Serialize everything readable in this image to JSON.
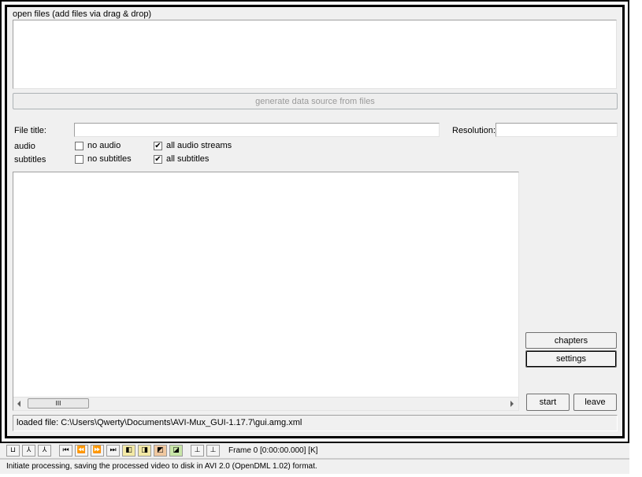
{
  "open_files": {
    "label": "open files (add files via drag & drop)",
    "generate_button": "generate data source from files"
  },
  "file_title": {
    "label": "File title:",
    "value": ""
  },
  "resolution": {
    "label": "Resolution:",
    "value": ""
  },
  "audio": {
    "label": "audio",
    "no_audio": {
      "label": "no audio",
      "checked": false
    },
    "all_streams": {
      "label": "all audio streams",
      "checked": true
    }
  },
  "subtitles": {
    "label": "subtitles",
    "no_subtitles": {
      "label": "no subtitles",
      "checked": false
    },
    "all_subtitles": {
      "label": "all subtitles",
      "checked": true
    }
  },
  "stream_list": {
    "scroll_grip": "III"
  },
  "buttons": {
    "chapters": "chapters",
    "settings": "settings",
    "start": "start",
    "leave": "leave"
  },
  "loaded_file": "loaded file: C:\\Users\\Qwerty\\Documents\\AVI-Mux_GUI-1.17.7\\gui.amg.xml",
  "toolbar": {
    "frame_readout": "Frame 0 [0:00:00.000] [K]"
  },
  "status_text": "Initiate processing, saving the processed video to disk in AVI 2.0 (OpenDML 1.02) format."
}
